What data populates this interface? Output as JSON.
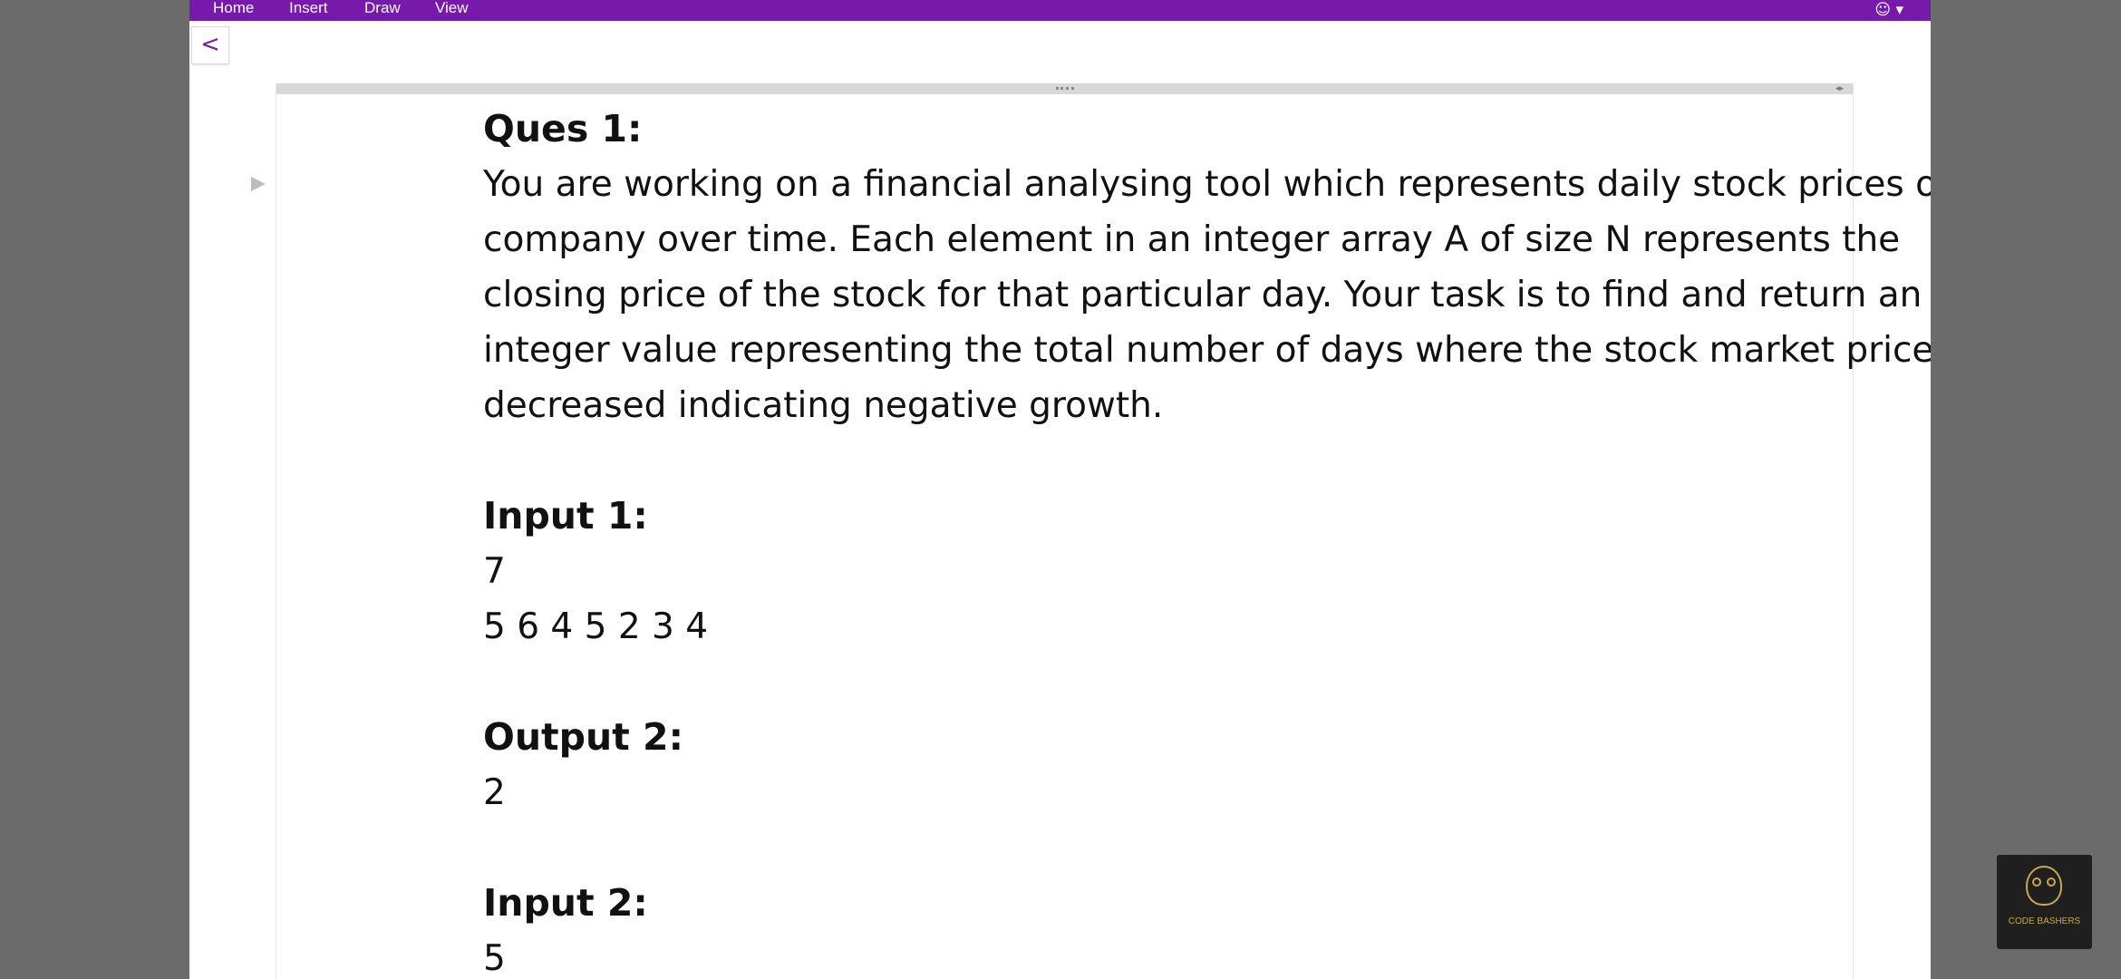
{
  "ribbon": {
    "tabs": [
      "Home",
      "Insert",
      "Draw",
      "View"
    ],
    "account_icon": "smiley-icon"
  },
  "back_button": {
    "icon": "chevron-left-icon",
    "label": "<"
  },
  "note": {
    "heading": "Ques 1:",
    "question_lines": [
      "You are working on a financial analysing tool which represents daily stock prices of a",
      "company over time. Each element in an integer array A of size N represents the",
      "closing price of the stock for that particular day. Your task is to find and return an",
      "integer value representing the total number of days where the stock market price",
      "decreased indicating negative growth."
    ],
    "input1_heading": "Input 1:",
    "input1_lines": [
      "7",
      "5 6 4 5 2 3 4"
    ],
    "output2_heading": "Output 2:",
    "output2_lines": [
      "2"
    ],
    "input2_heading": "Input 2:",
    "input2_lines": [
      "5"
    ]
  },
  "watermark": {
    "label": "CODE BASHERS"
  },
  "colors": {
    "ribbon": "#7719aa",
    "background": "#6b6b6b",
    "accent": "#c9a64a"
  }
}
